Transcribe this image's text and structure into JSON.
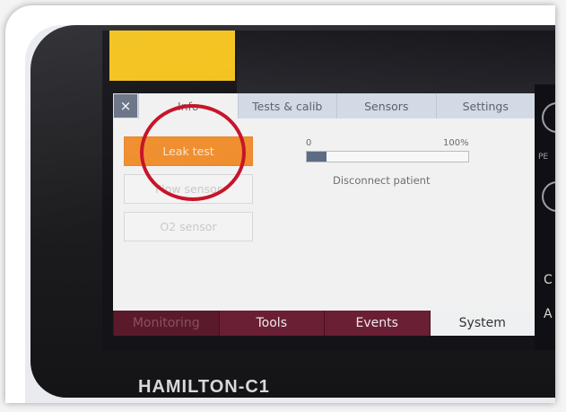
{
  "dialog": {
    "close_symbol": "×",
    "tabs": [
      {
        "label": "Info"
      },
      {
        "label": "Tests & calib"
      },
      {
        "label": "Sensors"
      },
      {
        "label": "Settings"
      }
    ],
    "buttons": {
      "leak_test": "Leak test",
      "second": "Flow sensor",
      "third": "O2 sensor"
    },
    "progress": {
      "min_label": "0",
      "max_label": "100%",
      "value_fraction": 0.12
    },
    "status": "Disconnect patient"
  },
  "bottom_nav": [
    {
      "label": "Monitoring"
    },
    {
      "label": "Tools"
    },
    {
      "label": "Events"
    },
    {
      "label": "System"
    }
  ],
  "right_strip": {
    "labels": [
      "PE",
      "C",
      "A"
    ]
  },
  "brand": "HAMILTON-C1",
  "colors": {
    "accent_orange": "#f08e2e",
    "nav_maroon": "#6a1f35",
    "annotation_red": "#c8142a",
    "bezel": "#1b1b1e"
  }
}
